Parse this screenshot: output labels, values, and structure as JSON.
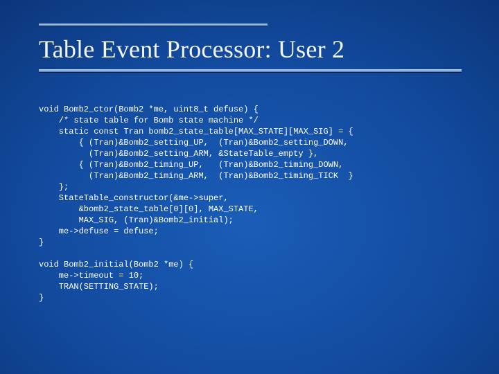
{
  "slide": {
    "title": "Table Event Processor: User 2",
    "code": "void Bomb2_ctor(Bomb2 *me, uint8_t defuse) {\n    /* state table for Bomb state machine */\n    static const Tran bomb2_state_table[MAX_STATE][MAX_SIG] = {\n        { (Tran)&Bomb2_setting_UP,  (Tran)&Bomb2_setting_DOWN,\n          (Tran)&Bomb2_setting_ARM, &StateTable_empty },\n        { (Tran)&Bomb2_timing_UP,   (Tran)&Bomb2_timing_DOWN,\n          (Tran)&Bomb2_timing_ARM,  (Tran)&Bomb2_timing_TICK  }\n    };\n    StateTable_constructor(&me->super,\n        &bomb2_state_table[0][0], MAX_STATE,\n        MAX_SIG, (Tran)&Bomb2_initial);\n    me->defuse = defuse;\n}\n\nvoid Bomb2_initial(Bomb2 *me) {\n    me->timeout = 10;\n    TRAN(SETTING_STATE);\n}"
  }
}
